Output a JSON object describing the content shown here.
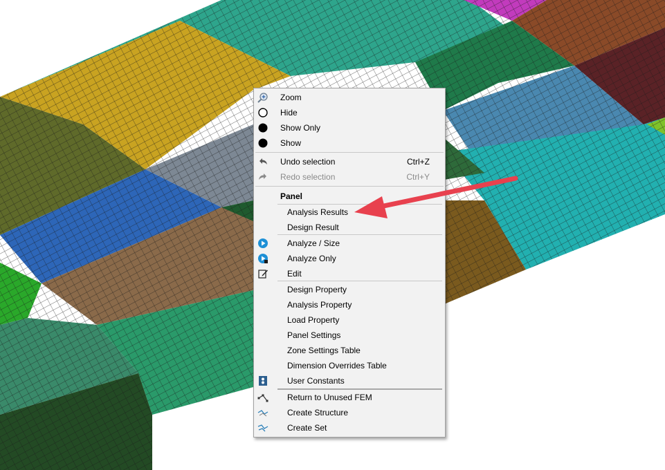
{
  "menu": {
    "zoom": "Zoom",
    "hide": "Hide",
    "show_only": "Show Only",
    "show": "Show",
    "undo": "Undo selection",
    "undo_shortcut": "Ctrl+Z",
    "redo": "Redo selection",
    "redo_shortcut": "Ctrl+Y",
    "panel_header": "Panel",
    "analysis_results": "Analysis Results",
    "design_result": "Design Result",
    "analyze_size": "Analyze / Size",
    "analyze_only": "Analyze Only",
    "edit": "Edit",
    "design_property": "Design Property",
    "analysis_property": "Analysis Property",
    "load_property": "Load Property",
    "panel_settings": "Panel Settings",
    "zone_settings_table": "Zone Settings Table",
    "dimension_overrides_table": "Dimension Overrides Table",
    "user_constants": "User Constants",
    "return_unused_fem": "Return to Unused FEM",
    "create_structure": "Create Structure",
    "create_set": "Create Set"
  },
  "colors": {
    "annotation_arrow": "#e8414e",
    "icon_blue": "#1e90d6"
  }
}
